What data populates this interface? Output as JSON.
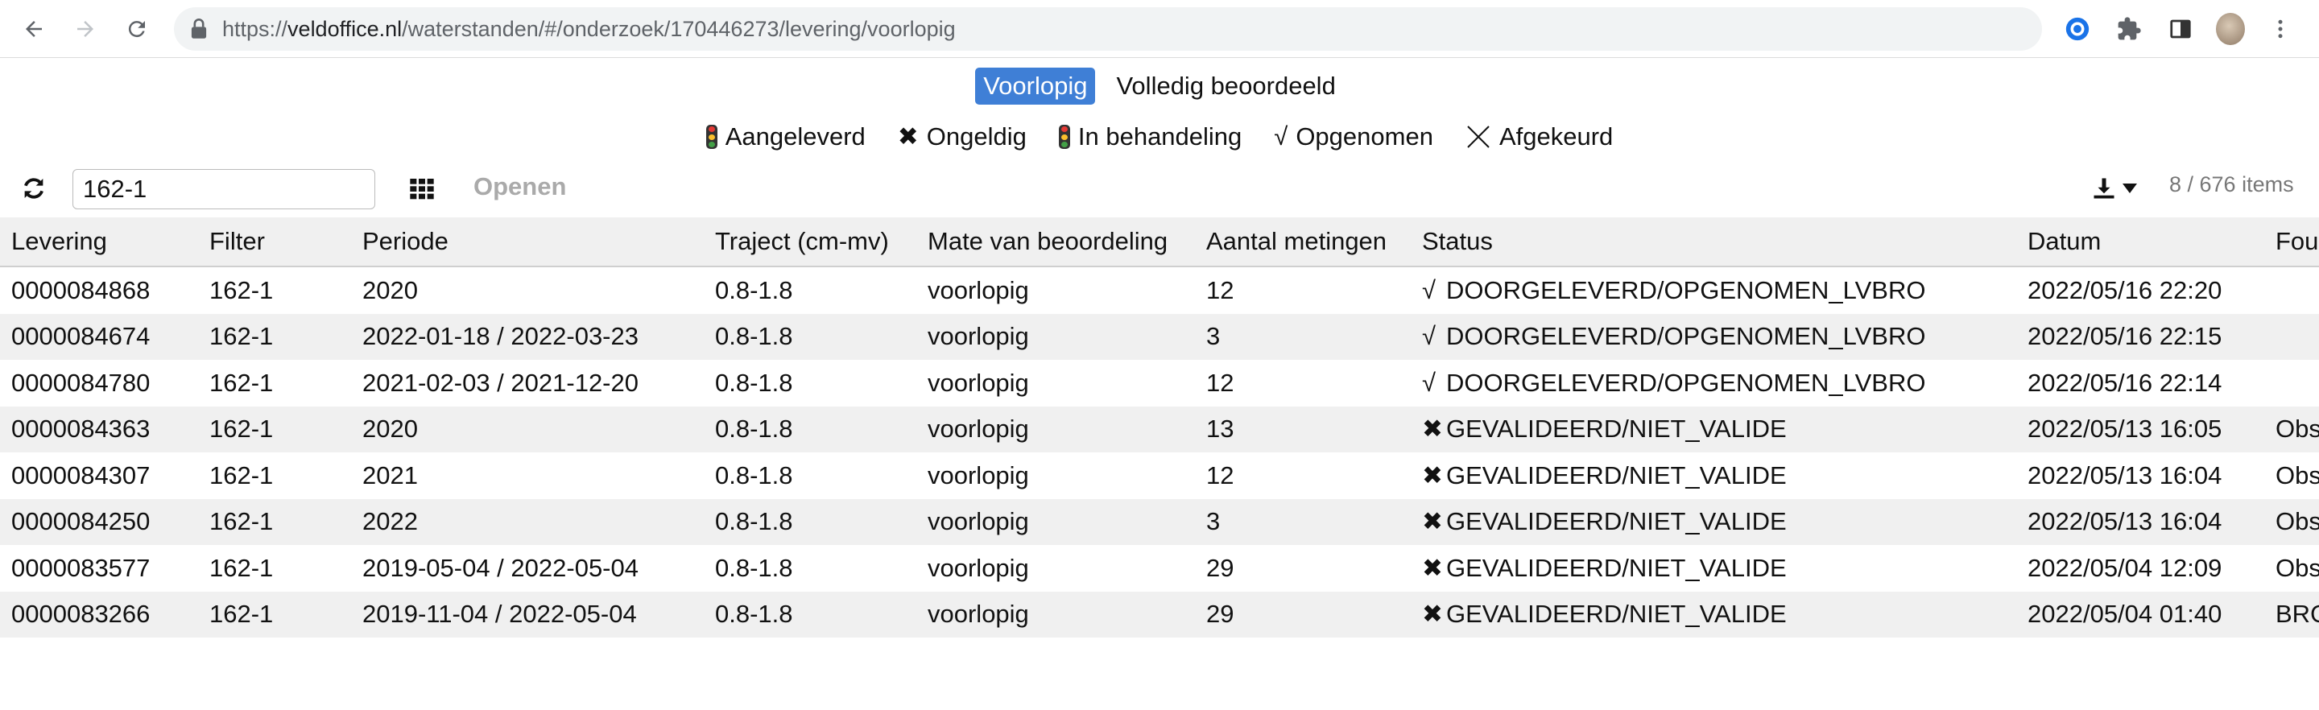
{
  "browser": {
    "url_prefix": "https://",
    "url_host": "veldoffice.nl",
    "url_path": "/waterstanden/#/onderzoek/170446273/levering/voorlopig"
  },
  "tabs": [
    "Voorlopig",
    "Volledig beoordeeld"
  ],
  "active_tab": "Voorlopig",
  "legend": {
    "aangeleverd": "Aangeleverd",
    "ongeldig": "Ongeldig",
    "in_behandeling": "In behandeling",
    "opgenomen": "Opgenomen",
    "afgekeurd": "Afgekeurd"
  },
  "toolbar": {
    "search_value": "162-1",
    "open_label": "Openen",
    "count_label": "8 / 676 items"
  },
  "table": {
    "columns": [
      "Levering",
      "Filter",
      "Periode",
      "Traject (cm-mv)",
      "Mate van beoordeling",
      "Aantal metingen",
      "Status",
      "Datum",
      "Fou"
    ],
    "rows": [
      {
        "levering": "0000084868",
        "filter": "162-1",
        "periode": "2020",
        "traject": "0.8-1.8",
        "mate": "voorlopig",
        "aantal": "12",
        "mark": "√",
        "status": "DOORGELEVERD/OPGENOMEN_LVBRO",
        "datum": "2022/05/16 22:20",
        "fout": ""
      },
      {
        "levering": "0000084674",
        "filter": "162-1",
        "periode": "2022-01-18 / 2022-03-23",
        "traject": "0.8-1.8",
        "mate": "voorlopig",
        "aantal": "3",
        "mark": "√",
        "status": "DOORGELEVERD/OPGENOMEN_LVBRO",
        "datum": "2022/05/16 22:15",
        "fout": ""
      },
      {
        "levering": "0000084780",
        "filter": "162-1",
        "periode": "2021-02-03 / 2021-12-20",
        "traject": "0.8-1.8",
        "mate": "voorlopig",
        "aantal": "12",
        "mark": "√",
        "status": "DOORGELEVERD/OPGENOMEN_LVBRO",
        "datum": "2022/05/16 22:14",
        "fout": ""
      },
      {
        "levering": "0000084363",
        "filter": "162-1",
        "periode": "2020",
        "traject": "0.8-1.8",
        "mate": "voorlopig",
        "aantal": "13",
        "mark": "✖",
        "status": "GEVALIDEERD/NIET_VALIDE",
        "datum": "2022/05/13 16:05",
        "fout": "Obs"
      },
      {
        "levering": "0000084307",
        "filter": "162-1",
        "periode": "2021",
        "traject": "0.8-1.8",
        "mate": "voorlopig",
        "aantal": "12",
        "mark": "✖",
        "status": "GEVALIDEERD/NIET_VALIDE",
        "datum": "2022/05/13 16:04",
        "fout": "Obs"
      },
      {
        "levering": "0000084250",
        "filter": "162-1",
        "periode": "2022",
        "traject": "0.8-1.8",
        "mate": "voorlopig",
        "aantal": "3",
        "mark": "✖",
        "status": "GEVALIDEERD/NIET_VALIDE",
        "datum": "2022/05/13 16:04",
        "fout": "Obs"
      },
      {
        "levering": "0000083577",
        "filter": "162-1",
        "periode": "2019-05-04 / 2022-05-04",
        "traject": "0.8-1.8",
        "mate": "voorlopig",
        "aantal": "29",
        "mark": "✖",
        "status": "GEVALIDEERD/NIET_VALIDE",
        "datum": "2022/05/04 12:09",
        "fout": "Obs"
      },
      {
        "levering": "0000083266",
        "filter": "162-1",
        "periode": "2019-11-04 / 2022-05-04",
        "traject": "0.8-1.8",
        "mate": "voorlopig",
        "aantal": "29",
        "mark": "✖",
        "status": "GEVALIDEERD/NIET_VALIDE",
        "datum": "2022/05/04 01:40",
        "fout": "BRO"
      }
    ]
  },
  "colors": {
    "accent": "#3f7fd6",
    "row_stripe": "#f0f0f0",
    "disabled_text": "#aaaaaa"
  }
}
